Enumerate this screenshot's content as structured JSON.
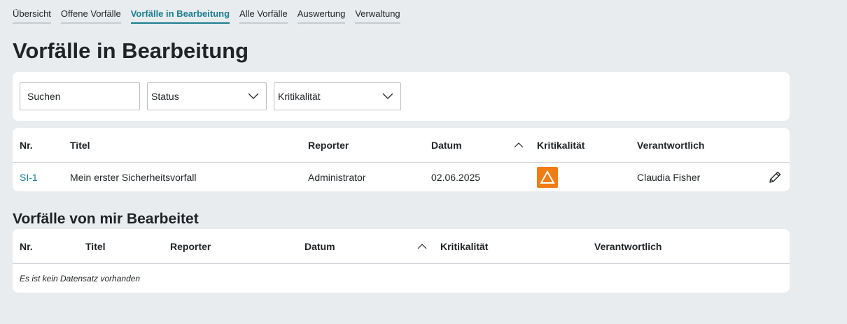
{
  "nav": {
    "tabs": [
      {
        "label": "Übersicht"
      },
      {
        "label": "Offene Vorfälle"
      },
      {
        "label": "Vorfälle in Bearbeitung"
      },
      {
        "label": "Alle Vorfälle"
      },
      {
        "label": "Auswertung"
      },
      {
        "label": "Verwaltung"
      }
    ],
    "active_index": 2
  },
  "page": {
    "title": "Vorfälle in Bearbeitung"
  },
  "filters": {
    "search_placeholder": "Suchen",
    "status_label": "Status",
    "criticality_label": "Kritikalität"
  },
  "table1": {
    "headers": {
      "nr": "Nr.",
      "title": "Titel",
      "reporter": "Reporter",
      "date": "Datum",
      "criticality": "Kritikalität",
      "owner": "Verantwortlich"
    },
    "sort_column": "Datum",
    "rows": [
      {
        "nr": "SI-1",
        "title": "Mein erster Sicherheitsvorfall",
        "reporter": "Administrator",
        "date": "02.06.2025",
        "criticality_icon": "warning-triangle-icon",
        "criticality_color": "#f07d13",
        "owner": "Claudia Fisher"
      }
    ]
  },
  "section2": {
    "title": "Vorfälle von mir Bearbeitet"
  },
  "table2": {
    "headers": {
      "nr": "Nr.",
      "title": "Titel",
      "reporter": "Reporter",
      "date": "Datum",
      "criticality": "Kritikalität",
      "owner": "Verantwortlich"
    },
    "sort_column": "Datum",
    "empty_message": "Es ist kein Datensatz vorhanden"
  },
  "colors": {
    "accent": "#1b7d8f",
    "background": "#e8ecef",
    "criticality_high": "#f07d13"
  }
}
